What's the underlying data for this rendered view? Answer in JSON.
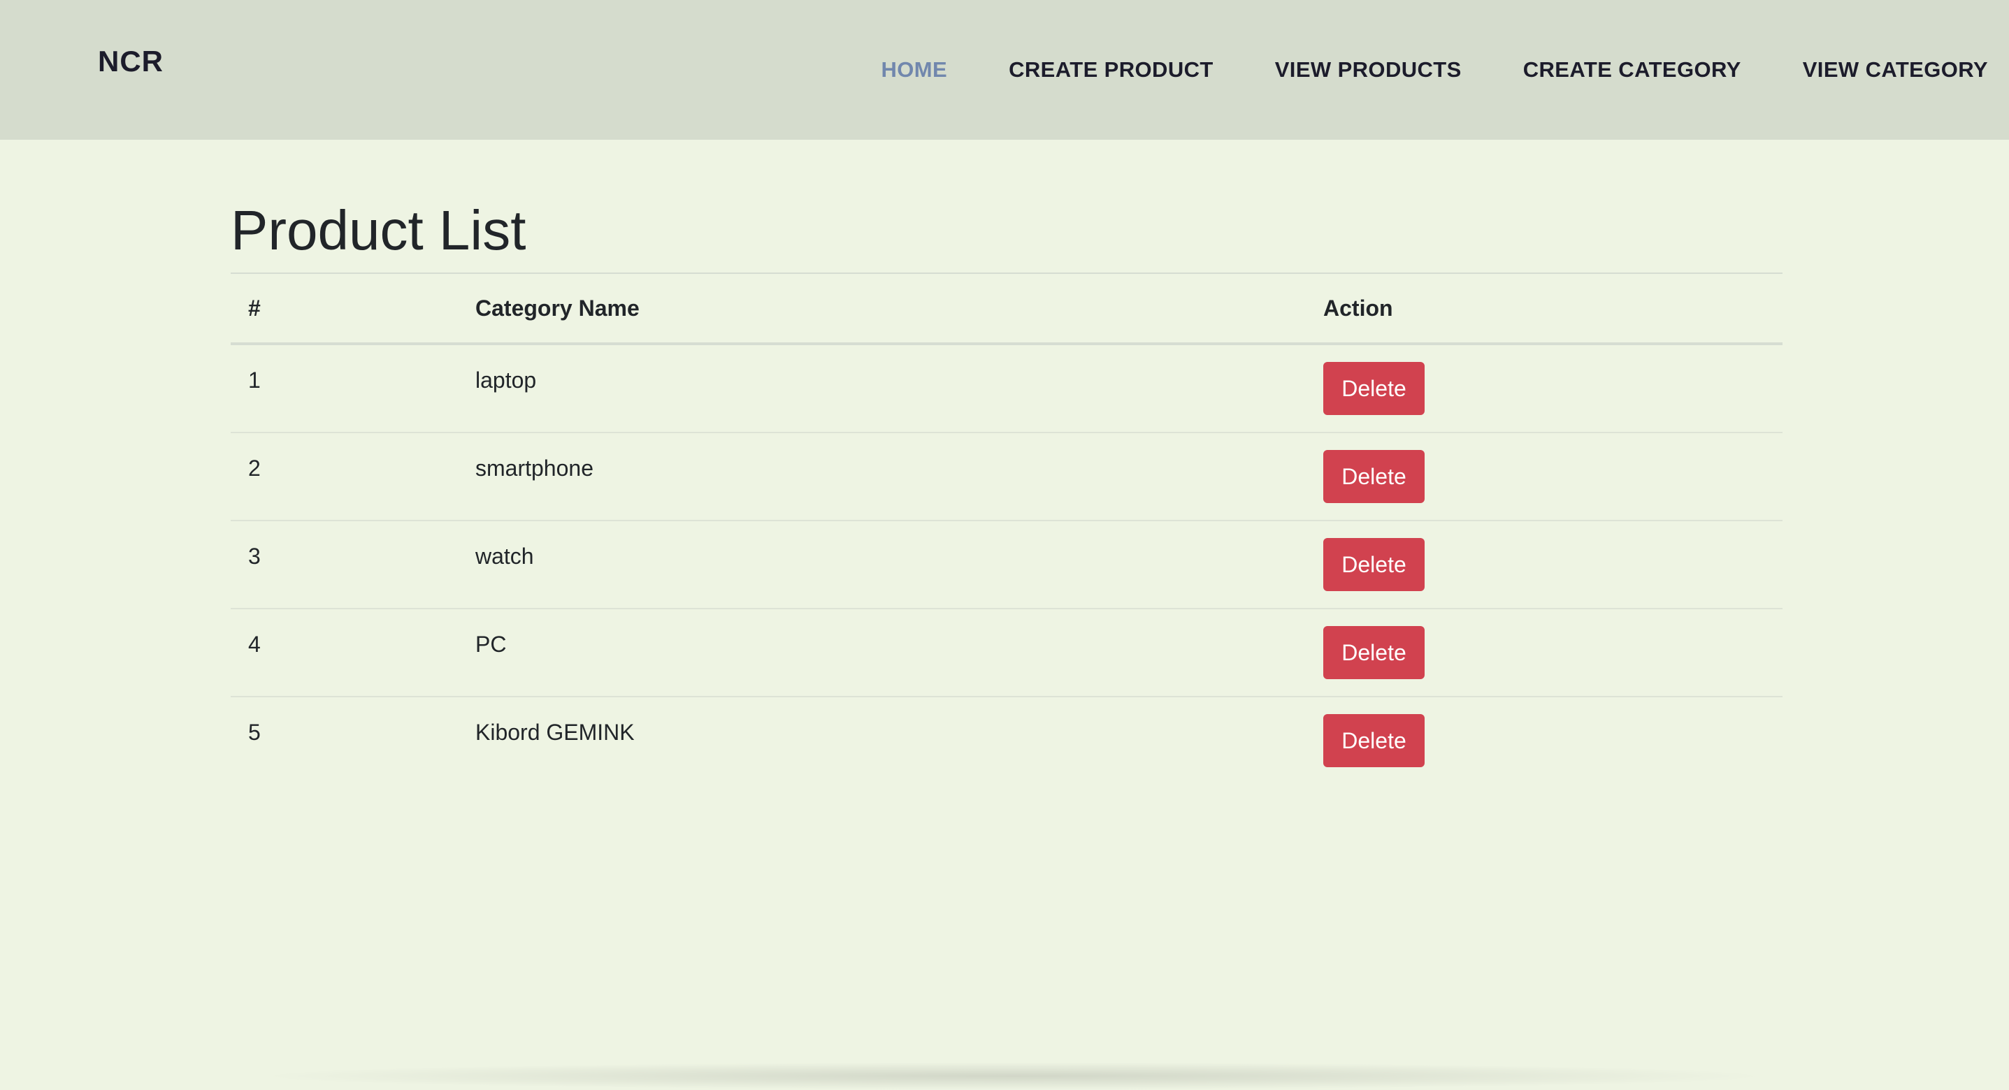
{
  "navbar": {
    "brand": "NCR",
    "links": [
      {
        "label": "HOME",
        "active": true
      },
      {
        "label": "CREATE PRODUCT",
        "active": false
      },
      {
        "label": "VIEW PRODUCTS",
        "active": false
      },
      {
        "label": "CREATE CATEGORY",
        "active": false
      },
      {
        "label": "VIEW CATEGORY",
        "active": false
      }
    ]
  },
  "main": {
    "title": "Product List",
    "table": {
      "headers": [
        "#",
        "Category Name",
        "Action"
      ],
      "rows": [
        {
          "num": "1",
          "name": "laptop",
          "action": "Delete"
        },
        {
          "num": "2",
          "name": "smartphone",
          "action": "Delete"
        },
        {
          "num": "3",
          "name": "watch",
          "action": "Delete"
        },
        {
          "num": "4",
          "name": "PC",
          "action": "Delete"
        },
        {
          "num": "5",
          "name": "Kibord GEMINK",
          "action": "Delete"
        }
      ]
    }
  },
  "colors": {
    "navbar_bg": "#d5dccd",
    "page_bg": "#eef4e3",
    "active_link": "#7187ad",
    "delete_button": "#d1424f"
  }
}
